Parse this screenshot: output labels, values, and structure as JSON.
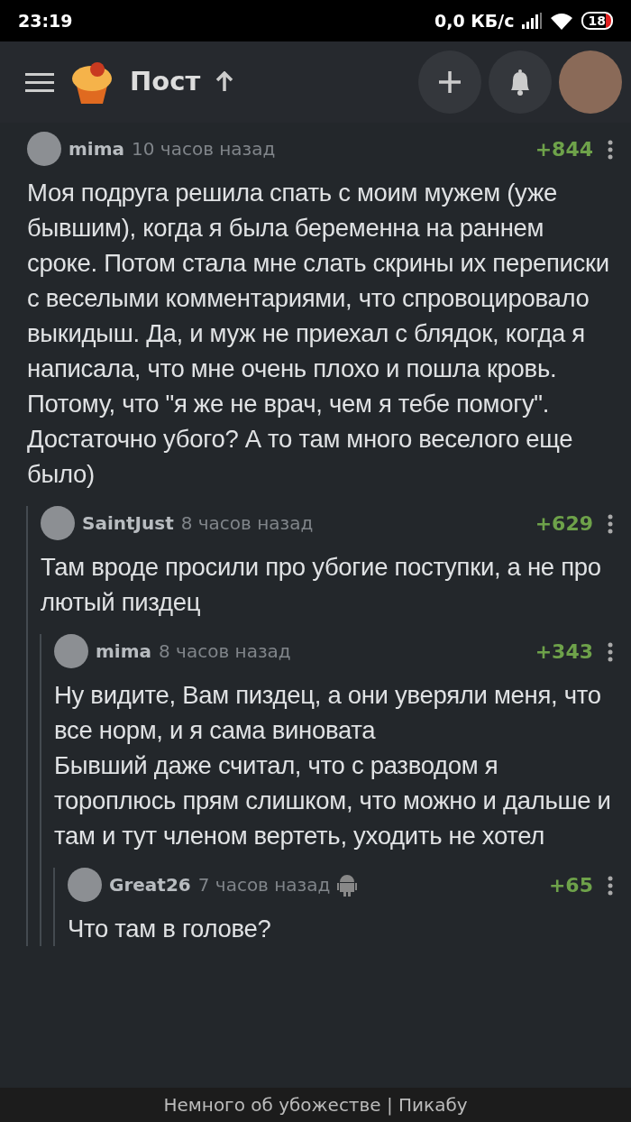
{
  "status_bar": {
    "time": "23:19",
    "network_speed": "0,0 КБ/с",
    "battery": "18"
  },
  "header": {
    "title": "Пост"
  },
  "comments": [
    {
      "author": "mima",
      "time": "10 часов назад",
      "score": "+844",
      "text": "Моя подруга решила спать с моим мужем (уже бывшим), когда я была беременна на раннем сроке. Потом стала мне слать скрины их переписки с веселыми комментариями, что спровоцировало выкидыш. Да, и муж не приехал с блядок, когда я написала, что мне очень плохо и пошла кровь. Потому, что \"я же не врач, чем я тебе помогу\".\nДостаточно убого? А то там много веселого еще было)",
      "children": [
        {
          "author": "SaintJust",
          "time": "8 часов назад",
          "score": "+629",
          "text": "Там вроде просили про убогие поступки, а не про лютый пиздец",
          "children": [
            {
              "author": "mima",
              "time": "8 часов назад",
              "score": "+343",
              "text": "Ну видите, Вам пиздец, а они уверяли меня, что все норм, и я сама виновата\nБывший даже считал, что с разводом я тороплюсь прям слишком, что можно и дальше и там и тут членом вертеть, уходить не хотел",
              "children": [
                {
                  "author": "Great26",
                  "time": "7 часов назад",
                  "score": "+65",
                  "android": true,
                  "text": "Что там в голове?"
                }
              ]
            }
          ]
        }
      ]
    }
  ],
  "footer": {
    "title": "Немного об убожестве | Пикабу"
  }
}
